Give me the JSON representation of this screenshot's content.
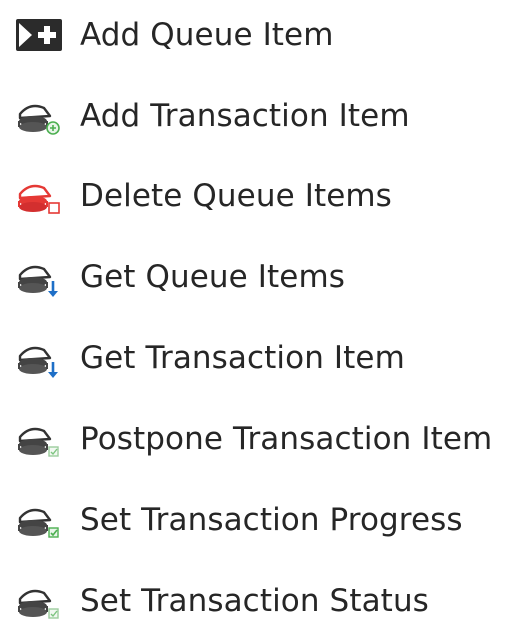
{
  "menu": {
    "items": [
      {
        "label": "Add Queue Item",
        "icon": "add-queue-item-icon",
        "accent": "#2b2b2b"
      },
      {
        "label": "Add Transaction Item",
        "icon": "add-transaction-item-icon",
        "accent": "#4caf50"
      },
      {
        "label": "Delete Queue Items",
        "icon": "delete-queue-items-icon",
        "accent": "#e53935"
      },
      {
        "label": "Get Queue Items",
        "icon": "get-queue-items-icon",
        "accent": "#1e6fc7"
      },
      {
        "label": "Get Transaction Item",
        "icon": "get-transaction-item-icon",
        "accent": "#1e6fc7"
      },
      {
        "label": "Postpone Transaction Item",
        "icon": "postpone-transaction-item-icon",
        "accent": "#7cc47f"
      },
      {
        "label": "Set Transaction Progress",
        "icon": "set-transaction-progress-icon",
        "accent": "#4caf50"
      },
      {
        "label": "Set Transaction Status",
        "icon": "set-transaction-status-icon",
        "accent": "#7cc47f"
      }
    ]
  }
}
